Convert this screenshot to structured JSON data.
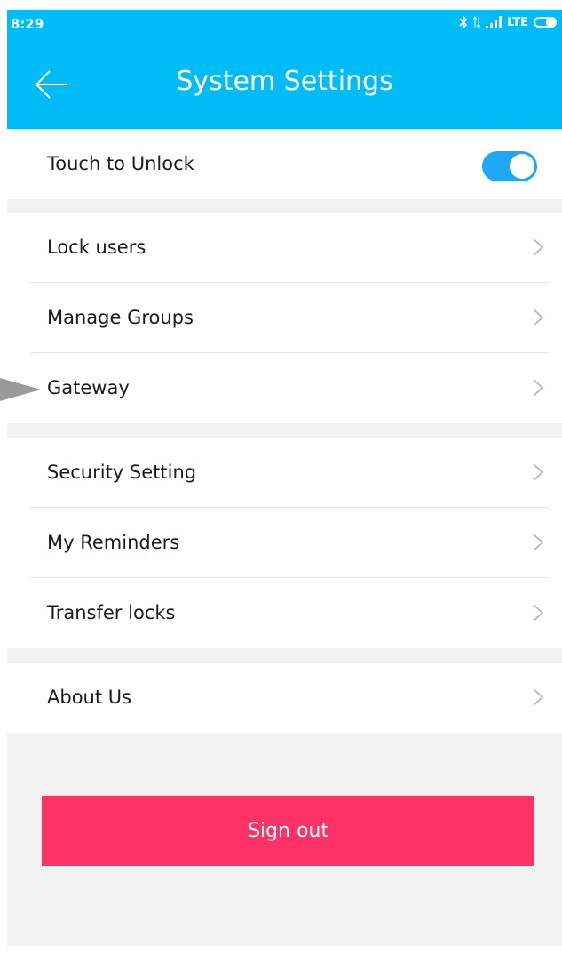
{
  "status_bar": {
    "time": "8:29",
    "network": "LTE",
    "icons": [
      "bluetooth-icon",
      "data-arrows-icon",
      "signal-icon",
      "battery-icon"
    ]
  },
  "header": {
    "title": "System Settings",
    "back_icon": "arrow-left-icon"
  },
  "settings": {
    "touch_unlock": {
      "label": "Touch to Unlock",
      "enabled": true
    },
    "lock_users": "Lock users",
    "manage_groups": "Manage Groups",
    "gateway": "Gateway",
    "security_setting": "Security Setting",
    "my_reminders": "My Reminders",
    "transfer_locks": "Transfer locks",
    "about_us": "About Us"
  },
  "sign_out_label": "Sign out",
  "colors": {
    "accent": "#00bcf6",
    "toggle_on": "#1ea7f4",
    "danger": "#ff3265",
    "background": "#f2f2f2"
  }
}
